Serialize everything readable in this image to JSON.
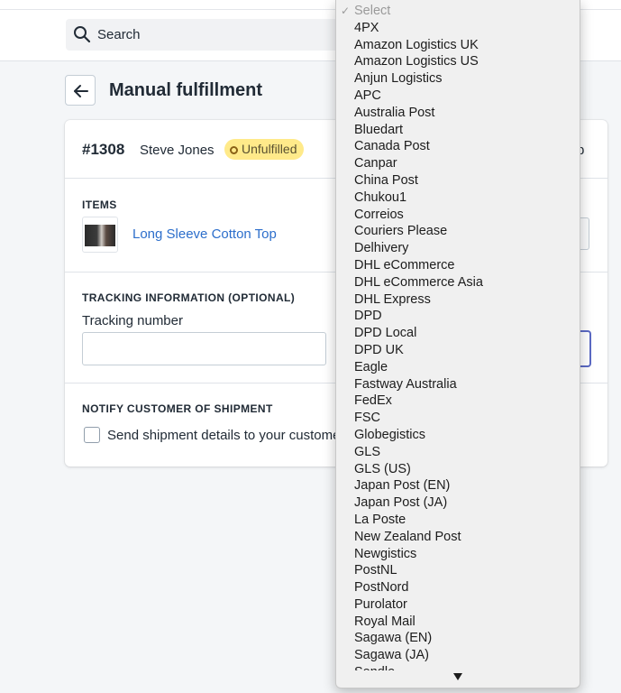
{
  "header": {
    "search_placeholder": "Search",
    "icons": {
      "search": "search-icon"
    }
  },
  "page": {
    "title": "Manual fulfillment",
    "back_icon": "arrow-left-icon"
  },
  "order": {
    "number": "#1308",
    "customer": "Steve Jones",
    "status": "Unfulfilled",
    "right_fragment": "p"
  },
  "items": {
    "heading": "ITEMS",
    "list": [
      {
        "name": "Long Sleeve Cotton Top"
      }
    ]
  },
  "tracking": {
    "heading": "TRACKING INFORMATION (OPTIONAL)",
    "number_label": "Tracking number",
    "number_value": ""
  },
  "notify": {
    "heading": "NOTIFY CUSTOMER OF SHIPMENT",
    "checkbox_label": "Send shipment details to your customer",
    "checked": false
  },
  "carrier_dropdown": {
    "selected": "Select",
    "options": [
      "Select",
      "4PX",
      "Amazon Logistics UK",
      "Amazon Logistics US",
      "Anjun Logistics",
      "APC",
      "Australia Post",
      "Bluedart",
      "Canada Post",
      "Canpar",
      "China Post",
      "Chukou1",
      "Correios",
      "Couriers Please",
      "Delhivery",
      "DHL eCommerce",
      "DHL eCommerce Asia",
      "DHL Express",
      "DPD",
      "DPD Local",
      "DPD UK",
      "Eagle",
      "Fastway Australia",
      "FedEx",
      "FSC",
      "Globegistics",
      "GLS",
      "GLS (US)",
      "Japan Post (EN)",
      "Japan Post (JA)",
      "La Poste",
      "New Zealand Post",
      "Newgistics",
      "PostNL",
      "PostNord",
      "Purolator",
      "Royal Mail",
      "Sagawa (EN)",
      "Sagawa (JA)",
      "Sendle"
    ],
    "scroll_icon": "triangle-down-icon"
  },
  "colors": {
    "badge_bg": "#ffea8a",
    "link": "#2c6ecb",
    "focus_border": "#5c6ac4"
  }
}
